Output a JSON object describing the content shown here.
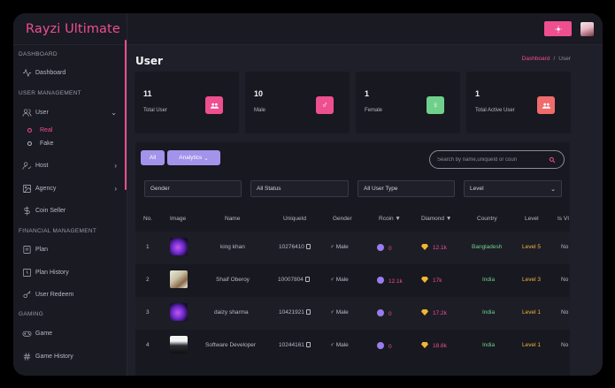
{
  "brand": "Rayzi Ultimate",
  "sidebar": {
    "sections": [
      "DASHBOARD",
      "USER MANAGEMENT",
      "FINANCIAL MANAGEMENT",
      "GAMING"
    ],
    "items": [
      {
        "label": "Dashboard",
        "icon": "activity-icon"
      },
      {
        "label": "User",
        "icon": "users-icon"
      },
      {
        "label": "Host",
        "icon": "user-check-icon"
      },
      {
        "label": "Agency",
        "icon": "image-icon"
      },
      {
        "label": "Coin Seller",
        "icon": "dollar-icon"
      },
      {
        "label": "Plan",
        "icon": "file-icon"
      },
      {
        "label": "Plan History",
        "icon": "clock-icon"
      },
      {
        "label": "User Redeem",
        "icon": "user-key-icon"
      },
      {
        "label": "Game",
        "icon": "gamepad-icon"
      },
      {
        "label": "Game History",
        "icon": "hash-icon"
      }
    ],
    "user_sub": [
      "Real",
      "Fake"
    ]
  },
  "page": {
    "title": "User",
    "breadcrumb": [
      "Dashboard",
      "/",
      "User"
    ]
  },
  "stats": [
    {
      "value": "11",
      "label": "Total User",
      "color": "#ee4f8f",
      "icon": "users-icon"
    },
    {
      "value": "10",
      "label": "Male",
      "color": "#ee4f8f",
      "icon": "male-icon"
    },
    {
      "value": "1",
      "label": "Female",
      "color": "#6fd08b",
      "icon": "female-icon"
    },
    {
      "value": "1",
      "label": "Total Active User",
      "color": "#f06c6c",
      "icon": "users-icon"
    }
  ],
  "toolbar": {
    "all_label": "All",
    "analytics_label": "Analytics",
    "search_placeholder": "Search by name,uniqueId or coun"
  },
  "filters": [
    "Gender",
    "All Status",
    "All User Type",
    "Level"
  ],
  "table": {
    "headers": [
      "No.",
      "Image",
      "Name",
      "UniqueId",
      "Gender",
      "Rcoin ▼",
      "Diamond ▼",
      "Country",
      "Level",
      "Is VI"
    ],
    "rows": [
      {
        "no": "1",
        "image": "purple",
        "name": "king khan",
        "uid": "10276410",
        "gender": "Male",
        "rcoin": "0",
        "diamond": "12.1k",
        "country": "Bangladesh",
        "level": "Level 5",
        "vip": "No"
      },
      {
        "no": "2",
        "image": "photo1",
        "name": "Shaif Oberoy",
        "uid": "10007804",
        "gender": "Male",
        "rcoin": "12.1k",
        "diamond": "17k",
        "country": "India",
        "level": "Level 3",
        "vip": "No"
      },
      {
        "no": "3",
        "image": "purple",
        "name": "daizy sharma",
        "uid": "10421921",
        "gender": "Male",
        "rcoin": "0",
        "diamond": "17.2k",
        "country": "India",
        "level": "Level 1",
        "vip": "No"
      },
      {
        "no": "4",
        "image": "photo2",
        "name": "Software Developer",
        "uid": "10244161",
        "gender": "Male",
        "rcoin": "0",
        "diamond": "18.8k",
        "country": "India",
        "level": "Level 1",
        "vip": "No"
      }
    ]
  },
  "colors": {
    "accent": "#ee4f8f",
    "purple_btn": "#a493ea",
    "panel": "#181820"
  }
}
